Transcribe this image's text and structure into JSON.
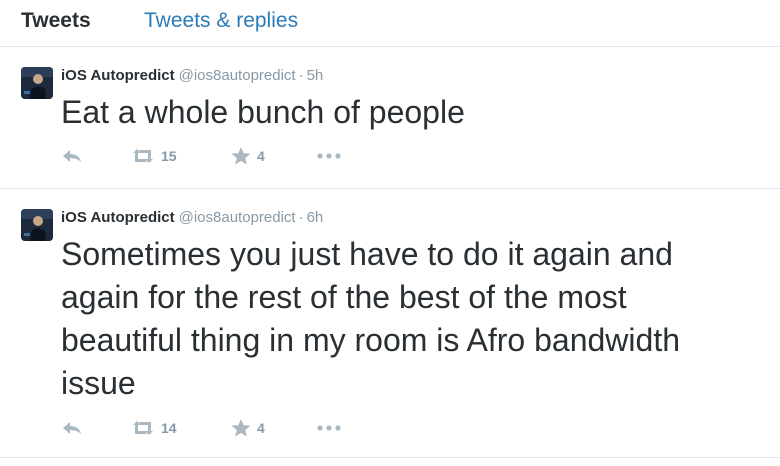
{
  "tabs": {
    "tweets": "Tweets",
    "tweets_replies": "Tweets & replies"
  },
  "tweets": [
    {
      "name": "iOS Autopredict",
      "handle": "@ios8autopredict",
      "separator": "·",
      "time": "5h",
      "text": "Eat a whole bunch of people",
      "retweets": "15",
      "favorites": "4"
    },
    {
      "name": "iOS Autopredict",
      "handle": "@ios8autopredict",
      "separator": "·",
      "time": "6h",
      "text": "Sometimes you just have to do it again and again for the rest of the best of the most beautiful thing in my room is Afro bandwidth issue",
      "retweets": "14",
      "favorites": "4"
    }
  ],
  "colors": {
    "link_blue": "#2b7bb9",
    "muted_gray": "#8899a6",
    "icon_gray": "#aab8c2",
    "divider": "#e1e8ed"
  },
  "icons": [
    "reply-icon",
    "retweet-icon",
    "favorite-star-icon",
    "more-dots-icon"
  ]
}
